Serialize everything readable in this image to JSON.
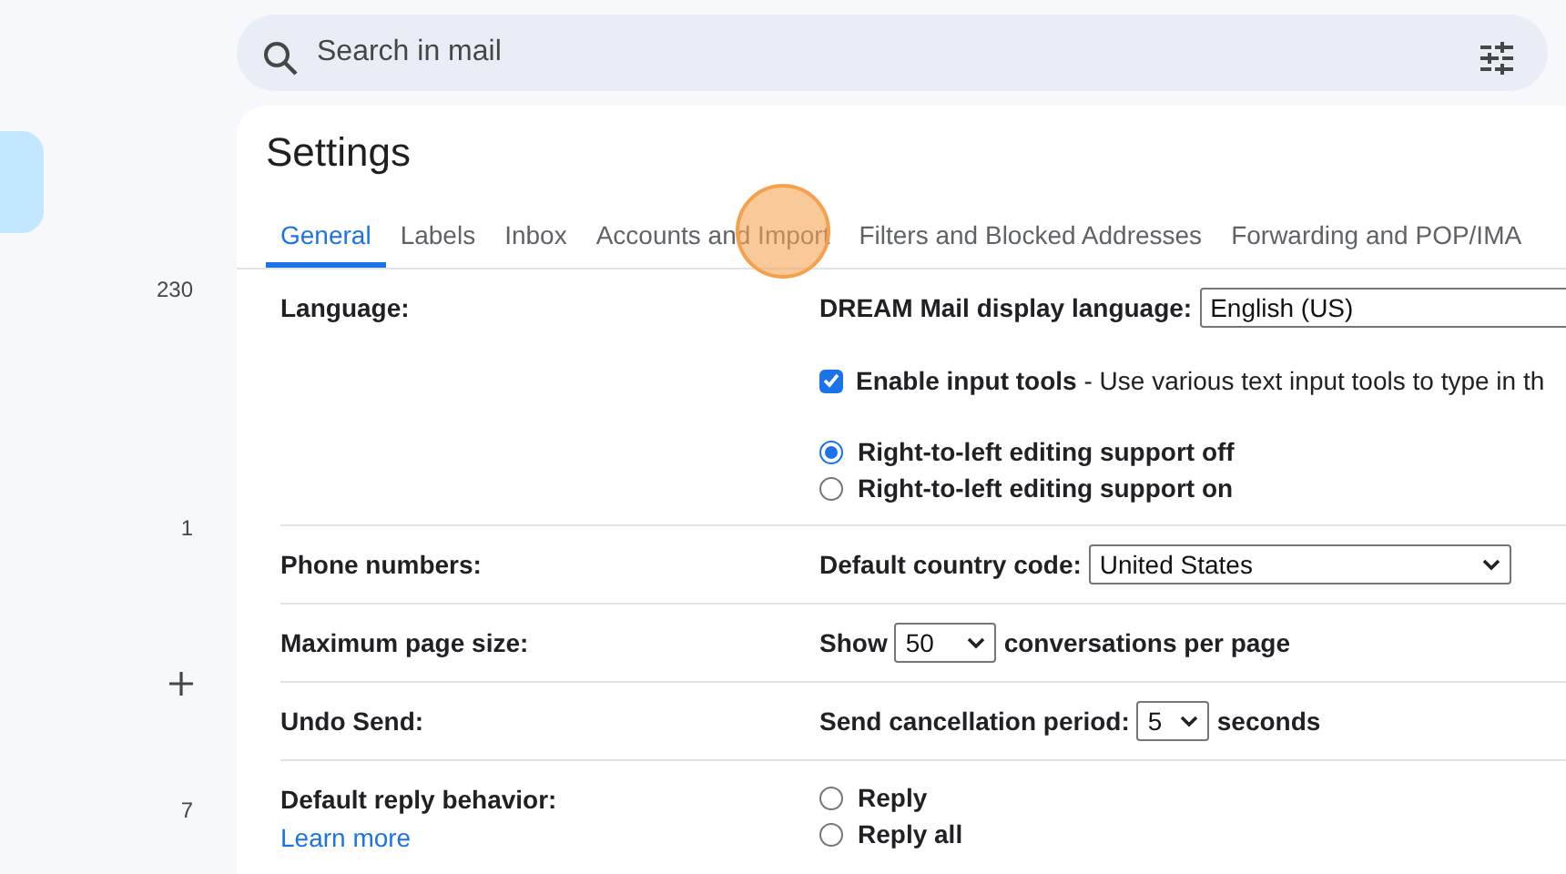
{
  "search": {
    "placeholder": "Search in mail"
  },
  "sidebar": {
    "items": [
      {
        "kind": "count",
        "text": "230"
      },
      {
        "kind": "count",
        "text": "1"
      },
      {
        "kind": "add"
      },
      {
        "kind": "count",
        "text": "7"
      }
    ]
  },
  "settings": {
    "title": "Settings",
    "tabs": [
      {
        "label": "General",
        "selected": true
      },
      {
        "label": "Labels",
        "selected": false
      },
      {
        "label": "Inbox",
        "selected": false
      },
      {
        "label": "Accounts and Import",
        "selected": false
      },
      {
        "label": "Filters and Blocked Addresses",
        "selected": false
      },
      {
        "label": "Forwarding and POP/IMA",
        "selected": false
      }
    ],
    "rows": [
      {
        "label": "Language:",
        "controls": [
          {
            "kind": "select",
            "prefix": "DREAM Mail display language:",
            "value": "English (US)"
          },
          {
            "kind": "checkbox",
            "checked": true,
            "text": "**Enable input tools** - Use various text input tools to type in th"
          },
          {
            "kind": "radio",
            "selected": true,
            "text": "Right-to-left editing support off"
          },
          {
            "kind": "radio",
            "selected": false,
            "text": "Right-to-left editing support on"
          }
        ]
      },
      {
        "label": "Phone numbers:",
        "controls": [
          {
            "kind": "select",
            "prefix": "Default country code:",
            "value": "United States"
          }
        ]
      },
      {
        "label": "Maximum page size:",
        "controls": [
          {
            "kind": "select",
            "prefix": "Show",
            "value": "50",
            "suffix": "conversations per page"
          }
        ]
      },
      {
        "label": "Undo Send:",
        "controls": [
          {
            "kind": "select",
            "prefix": "Send cancellation period:",
            "value": "5",
            "suffix": "seconds"
          }
        ]
      },
      {
        "label": "Default reply behavior:",
        "link": "Learn more",
        "controls": [
          {
            "kind": "radio",
            "selected": false,
            "text": "Reply"
          },
          {
            "kind": "radio",
            "selected": false,
            "text": "Reply all"
          }
        ]
      }
    ]
  }
}
